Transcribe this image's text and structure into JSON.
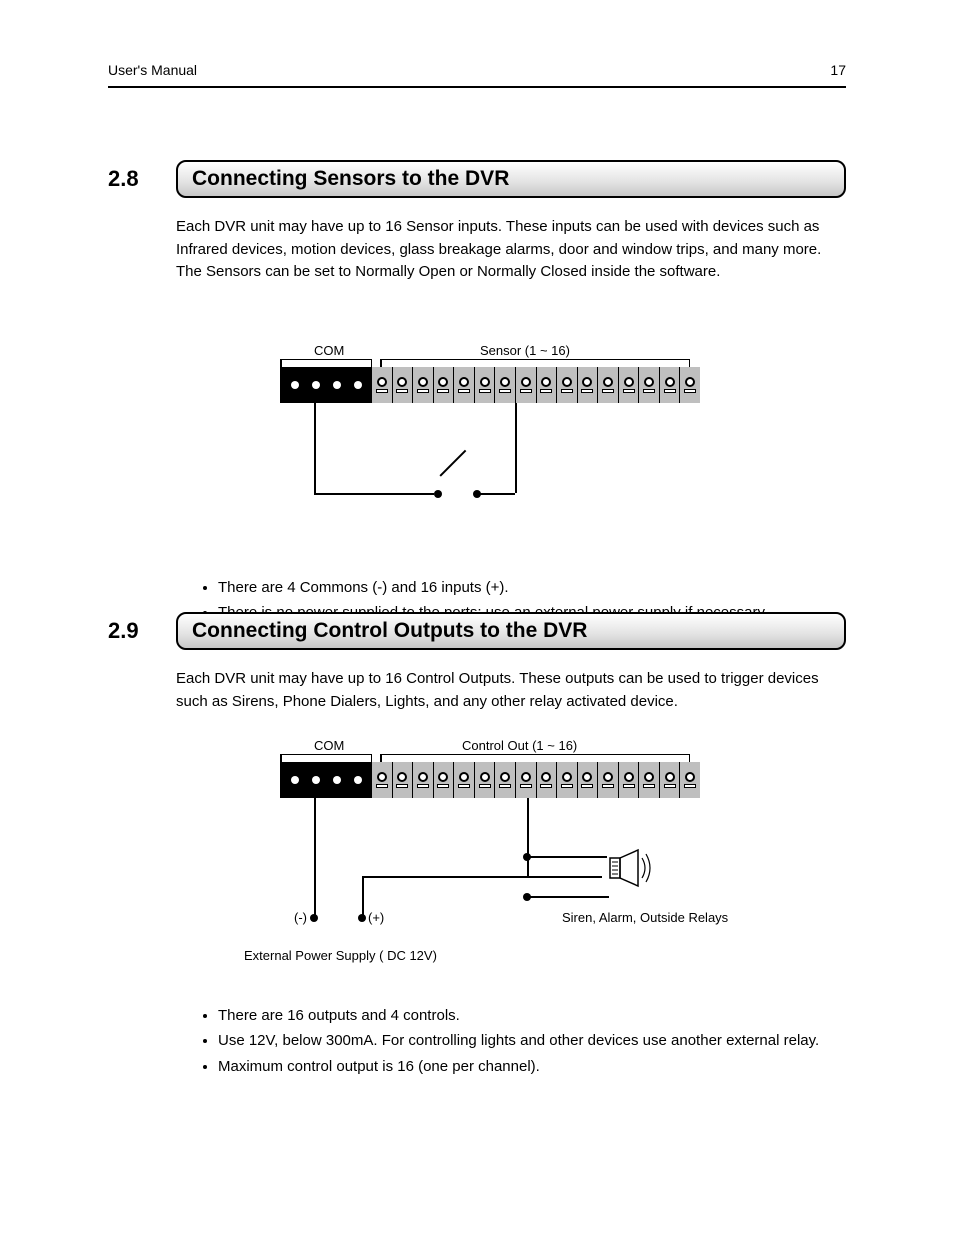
{
  "header": {
    "manual_title": "User's Manual",
    "page_number": "17"
  },
  "section28": {
    "number": "2.8",
    "title": "Connecting Sensors to the DVR",
    "body": "Each DVR unit may have up to 16 Sensor inputs. These inputs can be used with devices such as Infrared devices, motion devices, glass breakage alarms, door and window trips, and many more. The Sensors can be set to Normally Open or Normally Closed inside the software.",
    "diagram": {
      "com_label": "COM",
      "sensor_label": "Sensor (1 ~ 16)",
      "com_terminals": 4,
      "sensor_terminals": 16
    },
    "notes": [
      "There are 4 Commons (-) and 16 inputs (+).",
      "There is no power supplied to the ports; use an external power supply if necessary."
    ]
  },
  "section29": {
    "number": "2.9",
    "title": "Connecting Control Outputs to the DVR",
    "body": "Each DVR unit may have up to 16 Control Outputs. These outputs can be used to trigger devices such as Sirens, Phone Dialers, Lights, and any other relay activated device.",
    "diagram": {
      "com_label": "COM",
      "control_label": "Control Out (1 ~ 16)",
      "com_terminals": 4,
      "control_terminals": 16,
      "minus_label": "(-)",
      "plus_label": "(+)",
      "device_label": "Siren, Alarm, Outside Relays",
      "psu_label": "External Power Supply ( DC 12V)"
    },
    "notes": [
      "There are 16 outputs and 4 controls.",
      "Use 12V, below 300mA. For controlling lights and other devices use another external relay.",
      "Maximum control output is 16 (one per channel)."
    ]
  }
}
